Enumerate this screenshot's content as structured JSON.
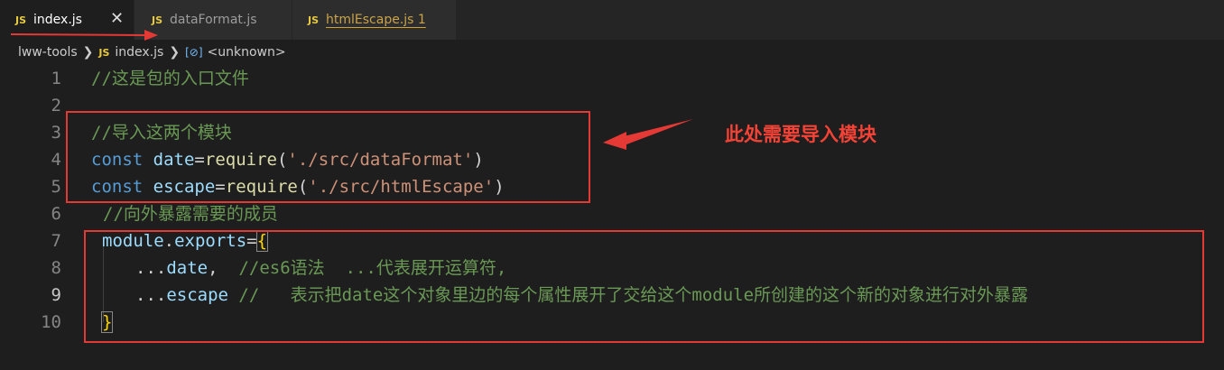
{
  "tabs": [
    {
      "icon": "JS",
      "label": "index.js",
      "close": "✕"
    },
    {
      "icon": "JS",
      "label": "dataFormat.js"
    },
    {
      "icon": "JS",
      "label": "htmlEscape.js 1"
    }
  ],
  "breadcrumb": {
    "root": "lww-tools",
    "file_icon": "JS",
    "file": "index.js",
    "symbol_icon": "[⊘]",
    "symbol": "<unknown>"
  },
  "lines": [
    {
      "num": "1",
      "comment": "//这是包的入口文件"
    },
    {
      "num": "2"
    },
    {
      "num": "3",
      "comment": "//导入这两个模块"
    },
    {
      "num": "4",
      "kw": "const",
      "var": "date",
      "eq": "=",
      "fn": "require",
      "open": "(",
      "str": "'./src/dataFormat'",
      "close": ")"
    },
    {
      "num": "5",
      "kw": "const",
      "var": "escape",
      "eq": "=",
      "fn": "require",
      "open": "(",
      "str": "'./src/htmlEscape'",
      "close": ")"
    },
    {
      "num": "6",
      "comment": "//向外暴露需要的成员"
    },
    {
      "num": "7",
      "obj": "module",
      "dot": ".",
      "prop": "exports",
      "eq": "=",
      "brace": "{"
    },
    {
      "num": "8",
      "spread": "...",
      "var": "date",
      "punct": ",",
      "comment": "//es6语法  ...代表展开运算符,"
    },
    {
      "num": "9",
      "spread": "...",
      "var": "escape",
      "comment": "//   表示把date这个对象里边的每个属性展开了交给这个module所创建的这个新的对象进行对外暴露"
    },
    {
      "num": "10",
      "brace": "}"
    }
  ],
  "annotation": {
    "note": "此处需要导入模块",
    "color": "#e53935"
  },
  "colors": {
    "background": "#1e1e1e",
    "tabbar": "#252526",
    "comment": "#6a9955",
    "keyword": "#569cd6",
    "variable": "#9cdcfe",
    "function": "#dcdcaa",
    "string": "#ce9178",
    "js_icon": "#e8c93f"
  }
}
